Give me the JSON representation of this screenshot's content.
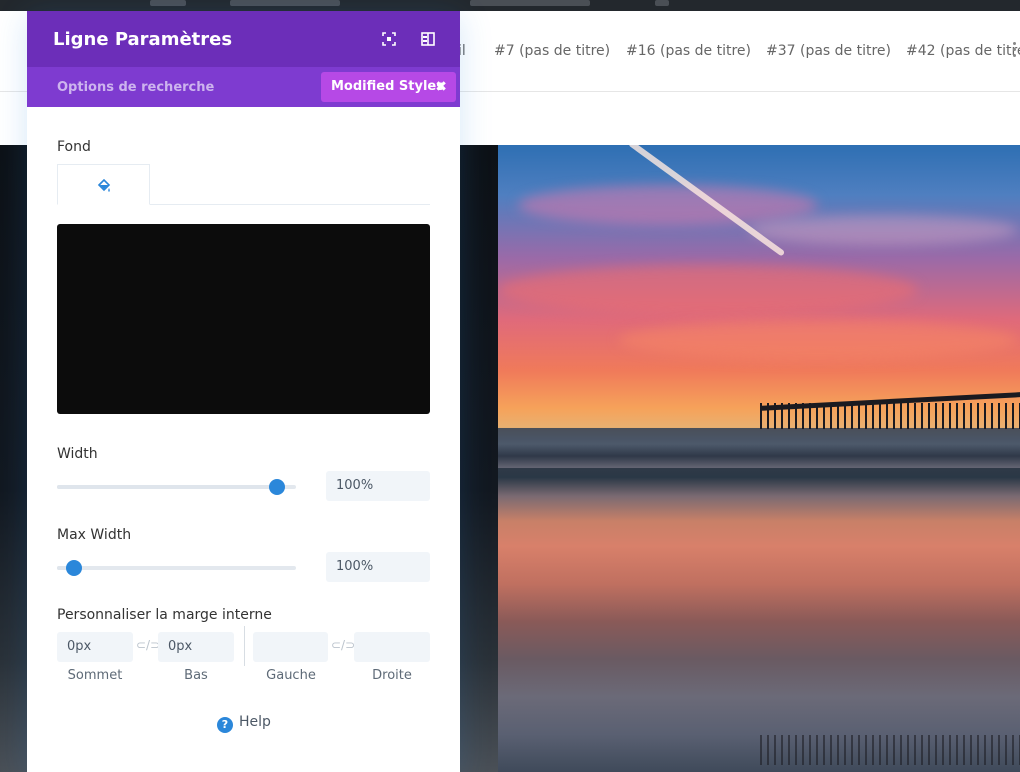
{
  "nav": {
    "partial": "il",
    "items": [
      "#7 (pas de titre)",
      "#16 (pas de titre)",
      "#37 (pas de titre)",
      "#42 (pas de titre)"
    ]
  },
  "modal": {
    "title": "Ligne Paramètres",
    "search_options": "Options de recherche",
    "modified_styles": "Modified Styles",
    "fond_label": "Fond",
    "width_label": "Width",
    "width_value": "100%",
    "width_slider_fraction": 0.92,
    "max_width_label": "Max Width",
    "max_width_value": "100%",
    "max_width_slider_fraction": 0.07,
    "padding_label": "Personnaliser la marge interne",
    "padding": {
      "sommet": "0px",
      "bas": "0px",
      "gauche": "",
      "droite": ""
    },
    "padding_labels": {
      "sommet": "Sommet",
      "bas": "Bas",
      "gauche": "Gauche",
      "droite": "Droite"
    },
    "link_glyph": "⊂/⊃",
    "help_label": "Help"
  },
  "colors": {
    "header": "#6c2eb9",
    "subbar": "#7e3bd0",
    "chip": "#b649e6",
    "accent": "#2b87da",
    "preview": "#0c0c0c"
  }
}
